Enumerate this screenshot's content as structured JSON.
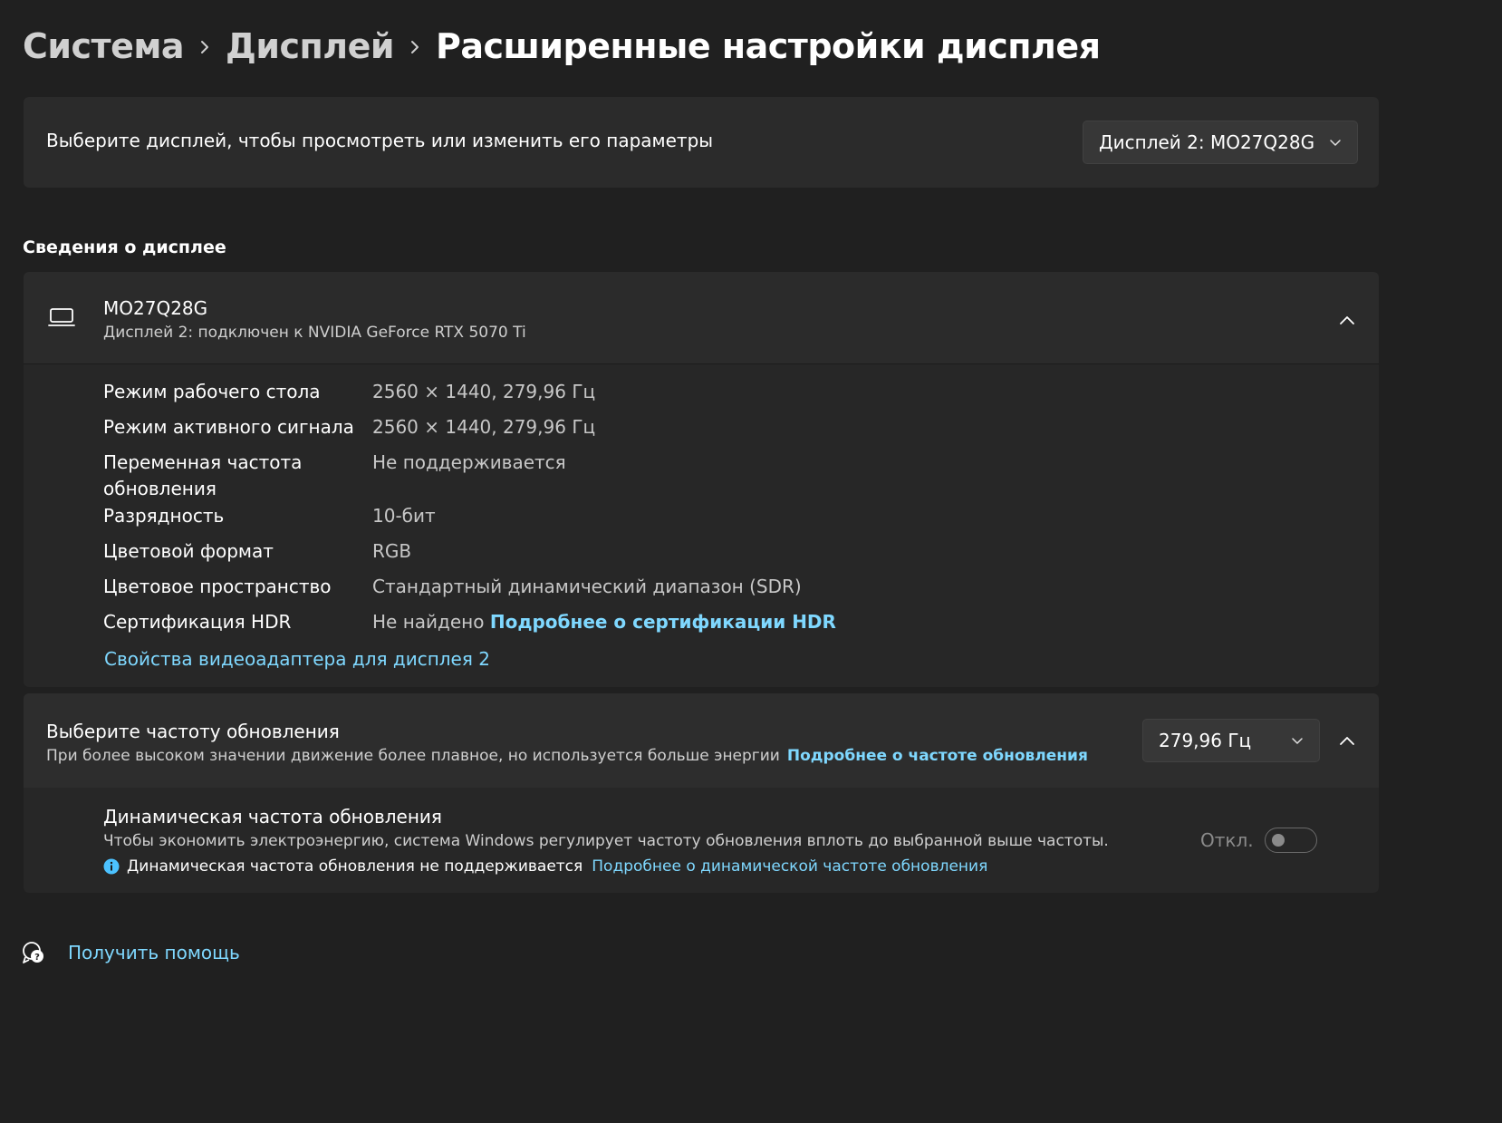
{
  "breadcrumb": {
    "items": [
      "Система",
      "Дисплей"
    ],
    "current": "Расширенные настройки дисплея"
  },
  "display_select": {
    "label": "Выберите дисплей, чтобы просмотреть или изменить его параметры",
    "selected": "Дисплей 2: MO27Q28G"
  },
  "display_info": {
    "section_title": "Сведения о дисплее",
    "name": "MO27Q28G",
    "subtitle": "Дисплей 2: подключен к NVIDIA GeForce RTX 5070 Ti",
    "specs": [
      {
        "label": "Режим рабочего стола",
        "value": "2560 × 1440, 279,96 Гц"
      },
      {
        "label": "Режим активного сигнала",
        "value": "2560 × 1440, 279,96 Гц"
      },
      {
        "label": "Переменная частота",
        "label2": "обновления",
        "value": "Не поддерживается"
      },
      {
        "label": "Разрядность",
        "value": "10-бит"
      },
      {
        "label": "Цветовой формат",
        "value": "RGB"
      },
      {
        "label": "Цветовое пространство",
        "value": "Стандартный динамический диапазон (SDR)"
      },
      {
        "label": "Сертификация HDR",
        "value": "Не найдено",
        "link": "Подробнее о сертификации HDR"
      }
    ],
    "adapter_link": "Свойства видеоадаптера для дисплея 2"
  },
  "refresh": {
    "title": "Выберите частоту обновления",
    "description": "При более высоком значении движение более плавное, но используется больше энергии",
    "link": "Подробнее о частоте обновления",
    "selected": "279,96 Гц",
    "dynamic": {
      "title": "Динамическая частота обновления",
      "description": "Чтобы экономить электроэнергию, система Windows регулирует частоту обновления вплоть до выбранной выше частоты.",
      "note": "Динамическая частота обновления не поддерживается",
      "note_link": "Подробнее о динамической частоте обновления",
      "toggle_label": "Откл."
    }
  },
  "help": {
    "label": "Получить помощь"
  },
  "colors": {
    "background": "#202020",
    "card": "#2b2b2b",
    "accent_link": "#7fd8ff",
    "info_blue": "#4cc2ff"
  }
}
